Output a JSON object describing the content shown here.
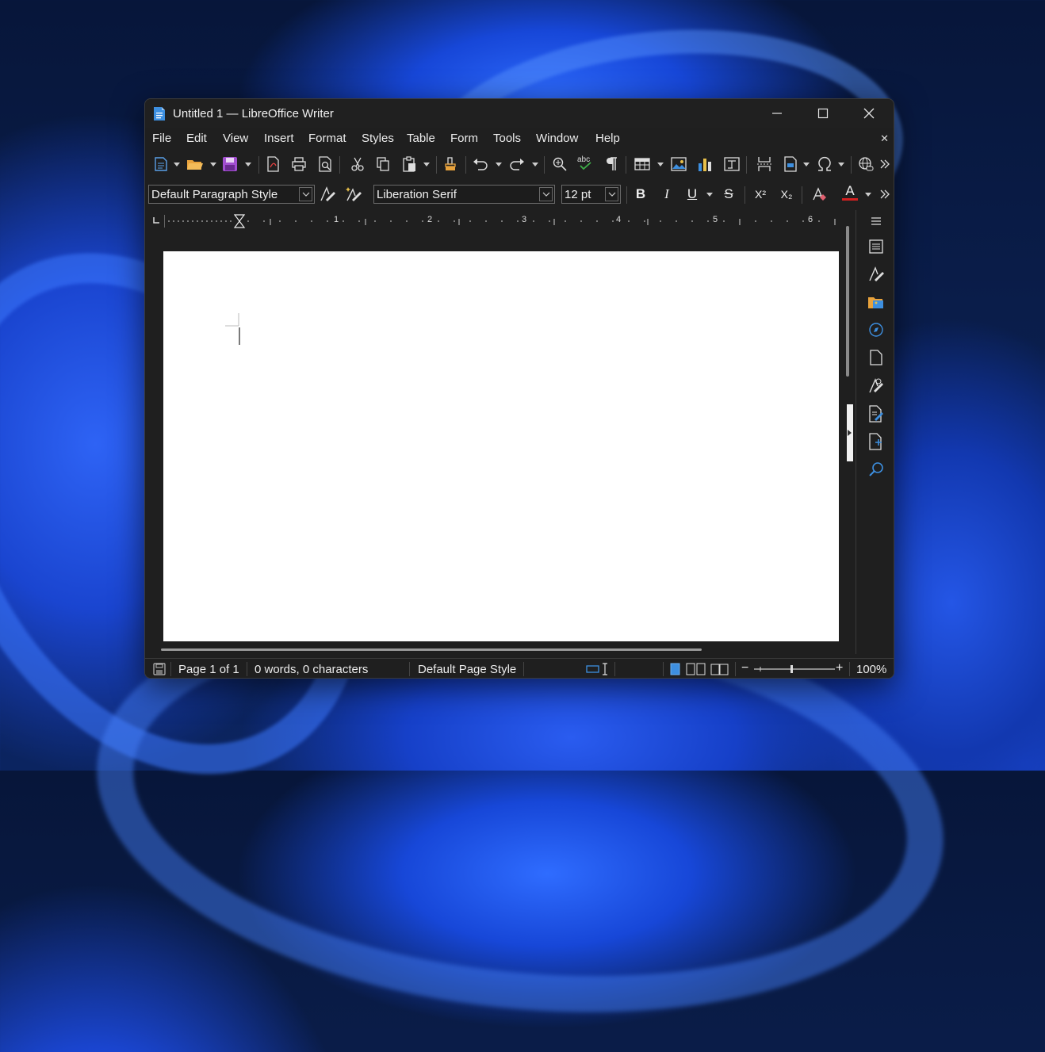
{
  "window": {
    "title": "Untitled 1 — LibreOffice Writer",
    "controls": {
      "minimize": "—",
      "maximize": "☐",
      "close": "✕"
    }
  },
  "menu": {
    "items": [
      "File",
      "Edit",
      "View",
      "Insert",
      "Format",
      "Styles",
      "Table",
      "Form",
      "Tools",
      "Window",
      "Help"
    ],
    "close_document": "✕"
  },
  "formatting": {
    "paragraph_style": "Default Paragraph Style",
    "font_name": "Liberation Serif",
    "font_size": "12 pt",
    "bold": "B",
    "italic": "I",
    "underline": "U",
    "strikethrough": "S",
    "superscript": "X²",
    "subscript": "X₂",
    "font_color_label": "A",
    "font_color": "#d42020"
  },
  "ruler": {
    "marks": [
      "1",
      "2",
      "3",
      "4",
      "5",
      "6"
    ]
  },
  "statusbar": {
    "page": "Page 1 of 1",
    "words": "0 words, 0 characters",
    "page_style": "Default Page Style",
    "zoom_minus": "−",
    "zoom_plus": "+",
    "zoom": "100%"
  },
  "colors": {
    "accent_blue": "#3d8fe0",
    "save_purple": "#a24fd0",
    "folder_orange": "#e8a23c",
    "chart_yellow": "#e8c04a",
    "spell_green": "#3fae49"
  }
}
